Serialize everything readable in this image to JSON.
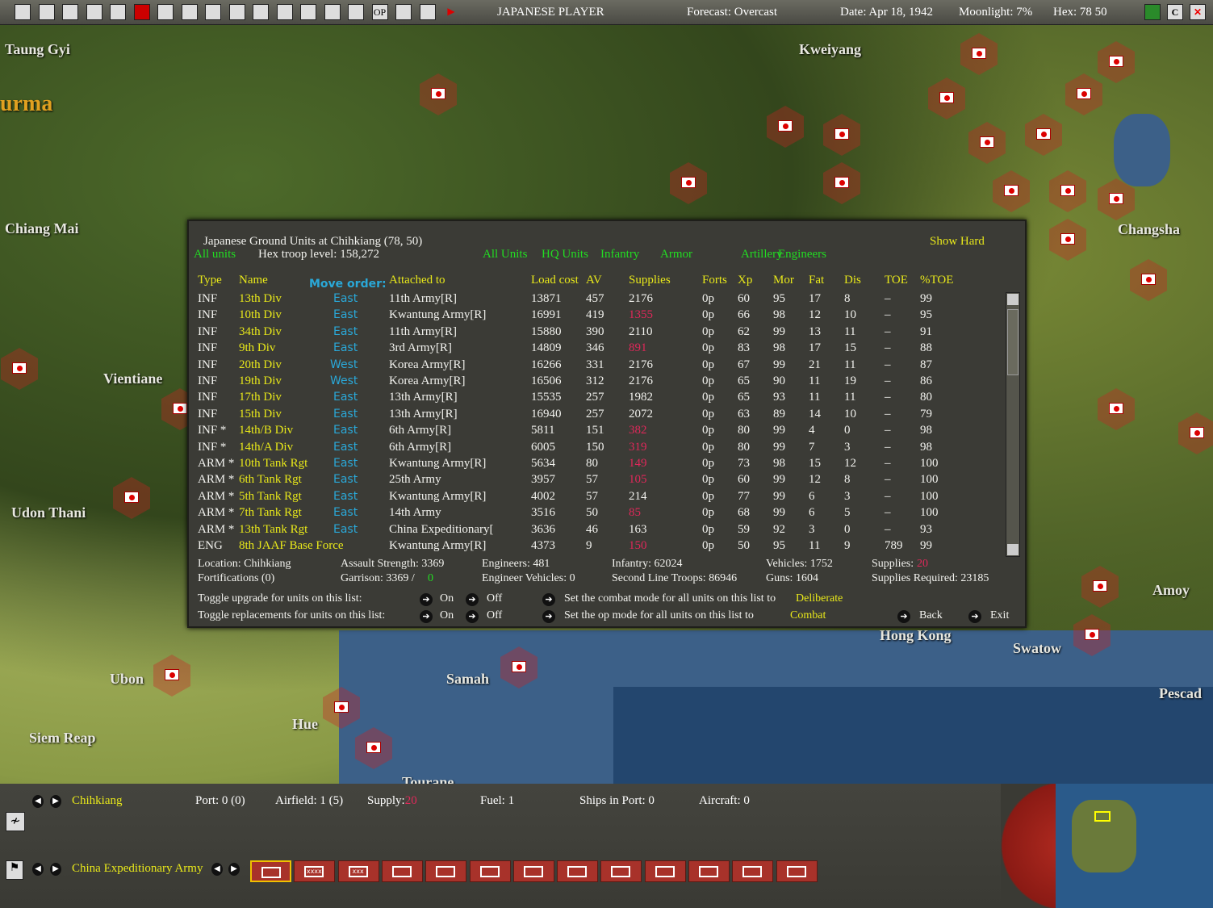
{
  "topbar": {
    "icons": [
      "map-icon",
      "list-icon",
      "ship-icon",
      "task-force-icon",
      "info-icon",
      "japan-flag-icon",
      "air-icon",
      "plane-icon",
      "flag-icon",
      "ground-icon",
      "orders-icon",
      "base-icon",
      "industry-icon",
      "globe-icon",
      "target-icon",
      "op-icon",
      "report-icon",
      "window-icon",
      "end-turn-icon"
    ],
    "op_label": "OP",
    "player": "JAPANESE PLAYER",
    "forecast": "Forecast: Overcast",
    "date": "Date: Apr 18, 1942",
    "moonlight": "Moonlight: 7%",
    "hex": "Hex: 78  50",
    "c_label": "C"
  },
  "map": {
    "labels": [
      "Taung Gyi",
      "urma",
      "Chiang Mai",
      "Vientiane",
      "Udon Thani",
      "Ubon",
      "Siem Reap",
      "Hue",
      "Tourane",
      "Samah",
      "Hong Kong",
      "Swatow",
      "Pescad",
      "Amoy",
      "Changsha",
      "Kweiyang"
    ]
  },
  "dialog": {
    "title": "Japanese Ground Units at Chihkiang  (78, 50)",
    "all_units_left": "All units",
    "troop_level": "Hex troop level: 158,272",
    "show_hard": "Show Hard",
    "filters": [
      "All Units",
      "HQ Units",
      "Infantry",
      "Armor",
      "Artillery",
      "Engineers"
    ],
    "columns": {
      "type": "Type",
      "name": "Name",
      "move": "Move order:",
      "attached": "Attached to",
      "load": "Load cost",
      "av": "AV",
      "supplies": "Supplies",
      "forts": "Forts",
      "xp": "Xp",
      "mor": "Mor",
      "fat": "Fat",
      "dis": "Dis",
      "toe": "TOE",
      "ptoe": "%TOE"
    },
    "rows": [
      {
        "type": "INF",
        "name": "13th Div",
        "move": "East",
        "attached": "11th Army[R]",
        "load": "13871",
        "av": "457",
        "supplies": "2176",
        "low": false,
        "forts": "0p",
        "xp": "60",
        "mor": "95",
        "fat": "17",
        "dis": "8",
        "toe": "–",
        "ptoe": "99"
      },
      {
        "type": "INF",
        "name": "10th Div",
        "move": "East",
        "attached": "Kwantung Army[R]",
        "load": "16991",
        "av": "419",
        "supplies": "1355",
        "low": true,
        "forts": "0p",
        "xp": "66",
        "mor": "98",
        "fat": "12",
        "dis": "10",
        "toe": "–",
        "ptoe": "95"
      },
      {
        "type": "INF",
        "name": "34th Div",
        "move": "East",
        "attached": "11th Army[R]",
        "load": "15880",
        "av": "390",
        "supplies": "2110",
        "low": false,
        "forts": "0p",
        "xp": "62",
        "mor": "99",
        "fat": "13",
        "dis": "11",
        "toe": "–",
        "ptoe": "91"
      },
      {
        "type": "INF",
        "name": "9th Div",
        "move": "East",
        "attached": "3rd Army[R]",
        "load": "14809",
        "av": "346",
        "supplies": "891",
        "low": true,
        "forts": "0p",
        "xp": "83",
        "mor": "98",
        "fat": "17",
        "dis": "15",
        "toe": "–",
        "ptoe": "88"
      },
      {
        "type": "INF",
        "name": "20th Div",
        "move": "West",
        "attached": "Korea Army[R]",
        "load": "16266",
        "av": "331",
        "supplies": "2176",
        "low": false,
        "forts": "0p",
        "xp": "67",
        "mor": "99",
        "fat": "21",
        "dis": "11",
        "toe": "–",
        "ptoe": "87"
      },
      {
        "type": "INF",
        "name": "19th Div",
        "move": "West",
        "attached": "Korea Army[R]",
        "load": "16506",
        "av": "312",
        "supplies": "2176",
        "low": false,
        "forts": "0p",
        "xp": "65",
        "mor": "90",
        "fat": "11",
        "dis": "19",
        "toe": "–",
        "ptoe": "86"
      },
      {
        "type": "INF",
        "name": "17th Div",
        "move": "East",
        "attached": "13th Army[R]",
        "load": "15535",
        "av": "257",
        "supplies": "1982",
        "low": false,
        "forts": "0p",
        "xp": "65",
        "mor": "93",
        "fat": "11",
        "dis": "11",
        "toe": "–",
        "ptoe": "80"
      },
      {
        "type": "INF",
        "name": "15th Div",
        "move": "East",
        "attached": "13th Army[R]",
        "load": "16940",
        "av": "257",
        "supplies": "2072",
        "low": false,
        "forts": "0p",
        "xp": "63",
        "mor": "89",
        "fat": "14",
        "dis": "10",
        "toe": "–",
        "ptoe": "79"
      },
      {
        "type": "INF *",
        "name": "14th/B Div",
        "move": "East",
        "attached": "6th Army[R]",
        "load": "5811",
        "av": "151",
        "supplies": "382",
        "low": true,
        "forts": "0p",
        "xp": "80",
        "mor": "99",
        "fat": "4",
        "dis": "0",
        "toe": "–",
        "ptoe": "98"
      },
      {
        "type": "INF *",
        "name": "14th/A Div",
        "move": "East",
        "attached": "6th Army[R]",
        "load": "6005",
        "av": "150",
        "supplies": "319",
        "low": true,
        "forts": "0p",
        "xp": "80",
        "mor": "99",
        "fat": "7",
        "dis": "3",
        "toe": "–",
        "ptoe": "98"
      },
      {
        "type": "ARM *",
        "name": "10th Tank Rgt",
        "move": "East",
        "attached": "Kwantung Army[R]",
        "load": "5634",
        "av": "80",
        "supplies": "149",
        "low": true,
        "forts": "0p",
        "xp": "73",
        "mor": "98",
        "fat": "15",
        "dis": "12",
        "toe": "–",
        "ptoe": "100"
      },
      {
        "type": "ARM *",
        "name": "6th Tank Rgt",
        "move": "East",
        "attached": "25th Army",
        "load": "3957",
        "av": "57",
        "supplies": "105",
        "low": true,
        "forts": "0p",
        "xp": "60",
        "mor": "99",
        "fat": "12",
        "dis": "8",
        "toe": "–",
        "ptoe": "100"
      },
      {
        "type": "ARM *",
        "name": "5th Tank Rgt",
        "move": "East",
        "attached": "Kwantung Army[R]",
        "load": "4002",
        "av": "57",
        "supplies": "214",
        "low": false,
        "forts": "0p",
        "xp": "77",
        "mor": "99",
        "fat": "6",
        "dis": "3",
        "toe": "–",
        "ptoe": "100"
      },
      {
        "type": "ARM *",
        "name": "7th Tank Rgt",
        "move": "East",
        "attached": "14th Army",
        "load": "3516",
        "av": "50",
        "supplies": "85",
        "low": true,
        "forts": "0p",
        "xp": "68",
        "mor": "99",
        "fat": "6",
        "dis": "5",
        "toe": "–",
        "ptoe": "100"
      },
      {
        "type": "ARM *",
        "name": "13th Tank Rgt",
        "move": "East",
        "attached": "China Expeditionary[",
        "load": "3636",
        "av": "46",
        "supplies": "163",
        "low": false,
        "forts": "0p",
        "xp": "59",
        "mor": "92",
        "fat": "3",
        "dis": "0",
        "toe": "–",
        "ptoe": "93"
      },
      {
        "type": "ENG",
        "name": "8th JAAF Base Force",
        "move": "",
        "attached": "Kwantung Army[R]",
        "load": "4373",
        "av": "9",
        "supplies": "150",
        "low": true,
        "forts": "0p",
        "xp": "50",
        "mor": "95",
        "fat": "11",
        "dis": "9",
        "toe": "789",
        "ptoe": "99"
      }
    ],
    "summary": {
      "location": "Location: Chihkiang",
      "fortifications": "Fortifications (0)",
      "assault": "Assault Strength: 3369",
      "garrison": "Garrison: 3369 /",
      "garrison_value": "0",
      "engineers": "Engineers: 481",
      "eng_vehicles": "Engineer Vehicles: 0",
      "infantry": "Infantry: 62024",
      "second_line": "Second Line Troops: 86946",
      "vehicles": "Vehicles: 1752",
      "guns": "Guns: 1604",
      "supplies_label": "Supplies:",
      "supplies_value": "20",
      "supplies_required": "Supplies Required: 23185"
    },
    "toggles": {
      "upgrade": "Toggle upgrade for units on this list:",
      "replacements": "Toggle replacements for units on this list:",
      "on": "On",
      "off": "Off",
      "combat_mode": "Set the combat mode for all units on this list to",
      "combat_value": "Deliberate",
      "op_mode": "Set the op mode for all units on this list to",
      "op_value": "Combat",
      "back": "Back",
      "exit": "Exit"
    }
  },
  "bottom": {
    "location": "Chihkiang",
    "port": "Port: 0 (0)",
    "airfield": "Airfield: 1 (5)",
    "supply_label": "Supply:",
    "supply_value": "20",
    "fuel": "Fuel: 1",
    "ships": "Ships in Port: 0",
    "aircraft": "Aircraft: 0",
    "hq": "China Expeditionary Army",
    "hq_units": [
      "",
      "xxxx",
      "xxx",
      "",
      "",
      "",
      "",
      "",
      "",
      "",
      "",
      "",
      ""
    ]
  },
  "colors": {
    "accent_yellow": "#e8e81a",
    "filter_green": "#22dd22",
    "move_blue": "#2aa8d8",
    "low_supply_red": "#e0285a"
  }
}
